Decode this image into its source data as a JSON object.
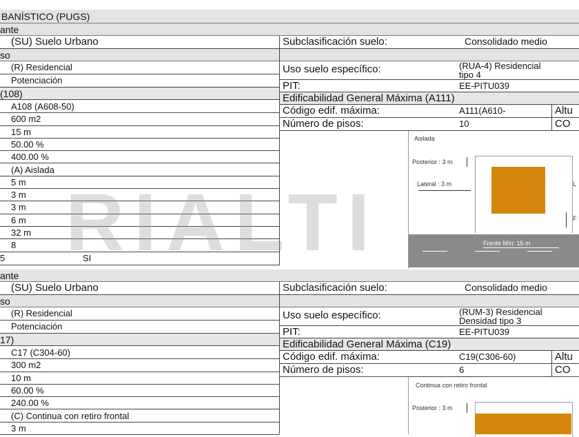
{
  "header": {
    "title": "BANÍSTICO (PUGS)"
  },
  "block1": {
    "section_1": "ante",
    "clasif": "(SU) Suelo Urbano",
    "subclas_label": "Subclasificación suelo:",
    "subclas_value": "Consolidado medio",
    "section_2": "so",
    "uso": "(R) Residencial",
    "uso_esp_label": "Uso suelo específico:",
    "uso_esp_value_1": "(RUA-4) Residencial",
    "uso_esp_value_2": "tipo 4",
    "tratamiento": "Potenciación",
    "pit_label": "PIT:",
    "pit_value": "EE-PITU039",
    "section_3": "(108)",
    "edif_header": "Edificabilidad General Máxima (A111)",
    "codigo_label": "Código edif. máxima:",
    "codigo_value": "A111(A610-",
    "codigo_extra": "Altu",
    "pisos_label": "Número de pisos:",
    "pisos_value": "10",
    "pisos_extra": "CO",
    "rows": [
      "A108 (A608-50)",
      "600 m2",
      "15 m",
      "50.00 %",
      "400.00 %",
      "(A) Aislada",
      "5 m",
      "3 m",
      "3 m",
      "6 m",
      "32 m",
      "8"
    ],
    "last_row_left": "5",
    "last_row_value": "SI",
    "diagram": {
      "title": "Aislada",
      "posterior": "Posterior : 3 m",
      "lateral": "Lateral : 3 m",
      "lateral_right": "L",
      "frontal_right": "F",
      "frente": "Frente Mín: 15 m"
    }
  },
  "block2": {
    "section_1": "ante",
    "clasif": "(SU) Suelo Urbano",
    "subclas_label": "Subclasificación suelo:",
    "subclas_value": "Consolidado medio",
    "section_2": "so",
    "uso": "(R) Residencial",
    "uso_esp_label": "Uso suelo específico:",
    "uso_esp_value_1": "(RUM-3) Residencial",
    "uso_esp_value_2": "Densidad tipo 3",
    "tratamiento": "Potenciación",
    "pit_label": "PIT:",
    "pit_value": "EE-PITU039",
    "section_3": "17)",
    "edif_header": "Edificabilidad General Máxima (C19)",
    "codigo_label": "Código edif. máxima:",
    "codigo_value": "C19(C306-60)",
    "codigo_extra": "Altu",
    "pisos_label": "Número de pisos:",
    "pisos_value": "6",
    "pisos_extra": "CO",
    "rows": [
      "C17 (C304-60)",
      "300 m2",
      "10 m",
      "60.00 %",
      "240.00 %",
      "(C) Continua con retiro frontal",
      "3 m"
    ],
    "diagram": {
      "title": "Continua con retiro frontal",
      "posterior": "Posterior : 3 m"
    }
  },
  "watermark": "RIALTI",
  "colors": {
    "building": "#d4860f",
    "band": "#e3e3e3",
    "road": "#8a8a8a"
  }
}
